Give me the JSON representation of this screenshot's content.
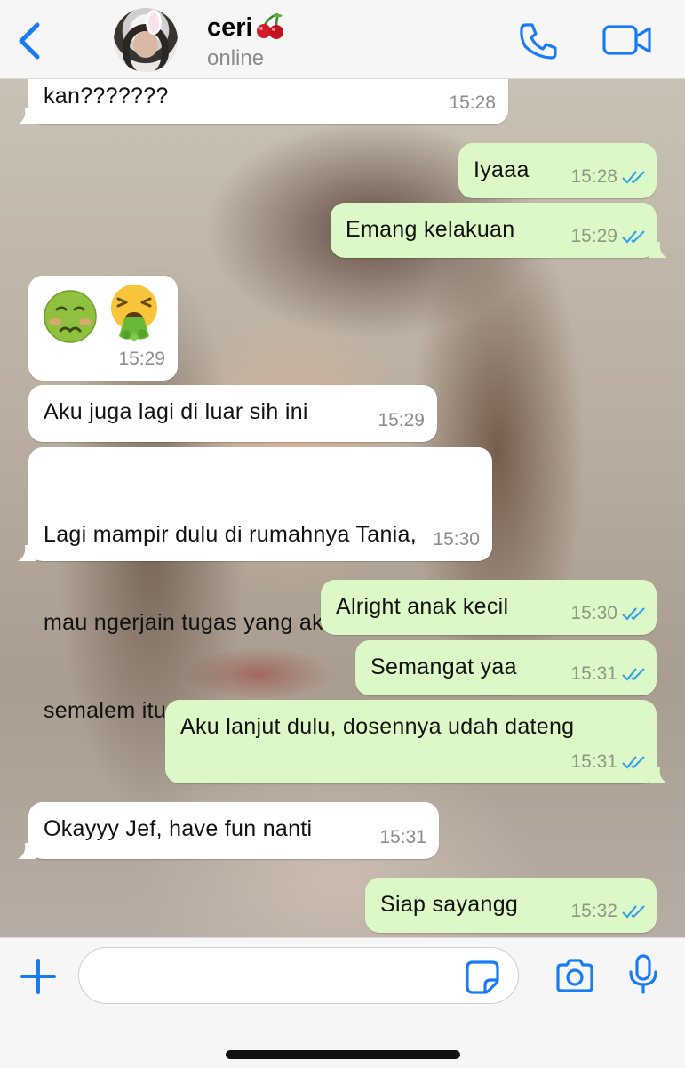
{
  "header": {
    "contact_name": "ceri",
    "contact_status": "online",
    "icons": [
      "back-chevron-icon",
      "cherry-emoji-icon",
      "phone-icon",
      "video-camera-icon"
    ]
  },
  "messages": [
    {
      "direction": "incoming",
      "text": "kan???????",
      "time": "15:28"
    },
    {
      "direction": "outgoing",
      "text": "Iyaaa",
      "time": "15:28",
      "read": true
    },
    {
      "direction": "outgoing",
      "text": "Emang kelakuan",
      "time": "15:29",
      "read": true
    },
    {
      "direction": "incoming",
      "emoji": [
        "nauseated-face",
        "face-vomiting"
      ],
      "time": "15:29"
    },
    {
      "direction": "incoming",
      "text": "Aku juga lagi di luar sih ini",
      "time": "15:29"
    },
    {
      "direction": "incoming",
      "lines": [
        "Lagi mampir dulu di rumahnya Tania,",
        "mau ngerjain tugas yang aku bilang",
        "semalem itu lohh"
      ],
      "time": "15:30"
    },
    {
      "direction": "outgoing",
      "text": "Alright anak kecil",
      "time": "15:30",
      "read": true
    },
    {
      "direction": "outgoing",
      "text": "Semangat yaa",
      "time": "15:31",
      "read": true
    },
    {
      "direction": "outgoing",
      "text": "Aku lanjut dulu, dosennya udah dateng",
      "time": "15:31",
      "read": true
    },
    {
      "direction": "incoming",
      "text": "Okayyy Jef, have fun nanti",
      "time": "15:31"
    },
    {
      "direction": "outgoing",
      "text": "Siap sayangg",
      "time": "15:32",
      "read": true
    }
  ],
  "composer": {
    "placeholder": "",
    "icons": [
      "plus-icon",
      "sticker-icon",
      "camera-icon",
      "microphone-icon"
    ]
  },
  "colors": {
    "accent": "#1a7cf5",
    "incoming_bubble": "#ffffff",
    "outgoing_bubble": "#dcf8c6",
    "read_ticks": "#3aa0e8",
    "timestamp": "#8c8c8c"
  }
}
